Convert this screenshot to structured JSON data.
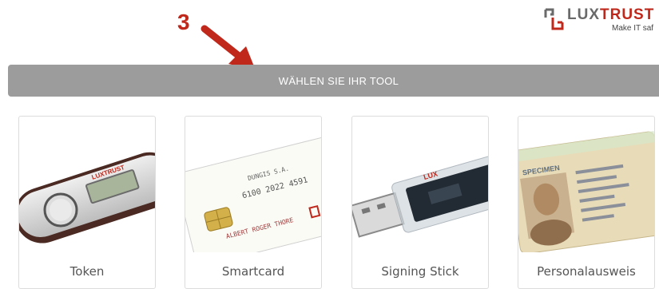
{
  "annotation": {
    "step_number": "3",
    "arrow_color": "#c0281b"
  },
  "logo": {
    "part1": "LUX",
    "part2": "TRUST",
    "tagline": "Make IT saf"
  },
  "banner": {
    "title": "WÄHLEN SIE IHR TOOL"
  },
  "tools": [
    {
      "label": "Token",
      "icon": "token-device-icon"
    },
    {
      "label": "Smartcard",
      "icon": "smartcard-icon",
      "card_text": {
        "line1": "DUNGIS S.A.",
        "line2": "6100 2022 4591",
        "line3": "ALBERT ROGER THORE"
      }
    },
    {
      "label": "Signing Stick",
      "icon": "usb-stick-icon"
    },
    {
      "label": "Personalausweis",
      "icon": "id-card-icon",
      "card_text": {
        "specimen": "SPECIMEN"
      }
    }
  ],
  "colors": {
    "banner": "#9c9c9c",
    "brand_red": "#c0281b",
    "brand_grey": "#6a6a6a"
  }
}
